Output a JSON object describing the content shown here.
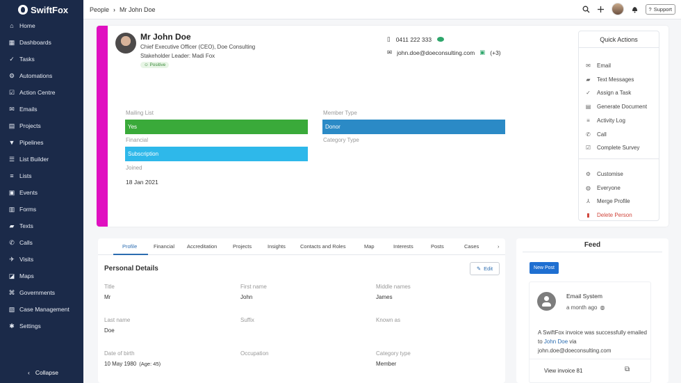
{
  "brand": {
    "name": "SwiftFox"
  },
  "sidebar": {
    "items": [
      {
        "label": "Home",
        "icon": "home-icon",
        "glyph": "⌂"
      },
      {
        "label": "Dashboards",
        "icon": "dashboard-icon",
        "glyph": "▦"
      },
      {
        "label": "Tasks",
        "icon": "tasks-icon",
        "glyph": "✓"
      },
      {
        "label": "Automations",
        "icon": "automations-icon",
        "glyph": "⚙"
      },
      {
        "label": "Action Centre",
        "icon": "action-centre-icon",
        "glyph": "☑"
      },
      {
        "label": "Emails",
        "icon": "email-icon",
        "glyph": "✉"
      },
      {
        "label": "Projects",
        "icon": "projects-icon",
        "glyph": "▤"
      },
      {
        "label": "Pipelines",
        "icon": "pipelines-icon",
        "glyph": "▼"
      },
      {
        "label": "List Builder",
        "icon": "list-builder-icon",
        "glyph": "☰"
      },
      {
        "label": "Lists",
        "icon": "lists-icon",
        "glyph": "≡"
      },
      {
        "label": "Events",
        "icon": "events-icon",
        "glyph": "▣"
      },
      {
        "label": "Forms",
        "icon": "forms-icon",
        "glyph": "▥"
      },
      {
        "label": "Texts",
        "icon": "texts-icon",
        "glyph": "▰"
      },
      {
        "label": "Calls",
        "icon": "calls-icon",
        "glyph": "✆"
      },
      {
        "label": "Visits",
        "icon": "visits-icon",
        "glyph": "✈"
      },
      {
        "label": "Maps",
        "icon": "maps-icon",
        "glyph": "◪"
      },
      {
        "label": "Governments",
        "icon": "governments-icon",
        "glyph": "⌘"
      },
      {
        "label": "Case Management",
        "icon": "case-management-icon",
        "glyph": "▧"
      },
      {
        "label": "Settings",
        "icon": "settings-icon",
        "glyph": "✱"
      }
    ],
    "collapse_label": "Collapse"
  },
  "header": {
    "breadcrumb": [
      "People",
      "Mr John Doe"
    ],
    "support_label": "Support"
  },
  "profile": {
    "name": "Mr John Doe",
    "role": "Chief Executive Officer (CEO),  Doe Consulting",
    "leader": "Stakeholder Leader:  Madi Fox",
    "sentiment": "Positive",
    "phone": "0411 222 333",
    "email": "john.doe@doeconsulting.com",
    "email_extra": "(+3)",
    "fields": {
      "mailing_list_label": "Mailing List",
      "mailing_list_value": "Yes",
      "financial_label": "Financial",
      "financial_value": "Subscription",
      "joined_label": "Joined",
      "joined_value": "18 Jan 2021",
      "member_type_label": "Member Type",
      "member_type_value": "Donor",
      "category_type_label": "Category Type"
    },
    "colors": {
      "accent": "#e010c0",
      "yes": "#3aaa3a",
      "subscription": "#2eb8ea",
      "donor": "#2b8ac6"
    }
  },
  "quick_actions": {
    "title": "Quick Actions",
    "items": [
      {
        "label": "Email",
        "icon": "email-icon",
        "glyph": "✉"
      },
      {
        "label": "Text Messages",
        "icon": "message-icon",
        "glyph": "▰"
      },
      {
        "label": "Assign a Task",
        "icon": "task-check-icon",
        "glyph": "✓"
      },
      {
        "label": "Generate Document",
        "icon": "document-icon",
        "glyph": "▤"
      },
      {
        "label": "Activity Log",
        "icon": "activity-log-icon",
        "glyph": "≡"
      },
      {
        "label": "Call",
        "icon": "phone-icon",
        "glyph": "✆"
      },
      {
        "label": "Complete Survey",
        "icon": "survey-icon",
        "glyph": "☑"
      }
    ],
    "secondary": [
      {
        "label": "Customise",
        "icon": "gear-icon",
        "glyph": "⚙"
      },
      {
        "label": "Everyone",
        "icon": "globe-icon",
        "glyph": "◍"
      },
      {
        "label": "Merge Profile",
        "icon": "merge-icon",
        "glyph": "⅄"
      },
      {
        "label": "Delete Person",
        "icon": "trash-icon",
        "glyph": "▮",
        "danger": true
      }
    ]
  },
  "tabs": [
    "Profile",
    "Financial",
    "Accreditation",
    "Projects",
    "Insights",
    "Contacts and Roles",
    "Map",
    "Interests",
    "Posts",
    "Cases"
  ],
  "personal_details": {
    "title": "Personal Details",
    "edit_label": "Edit",
    "fields": [
      {
        "label": "Title",
        "value": "Mr"
      },
      {
        "label": "First name",
        "value": "John"
      },
      {
        "label": "Middle names",
        "value": "James"
      },
      {
        "label": "Last name",
        "value": "Doe"
      },
      {
        "label": "Suffix",
        "value": ""
      },
      {
        "label": "Known as",
        "value": ""
      },
      {
        "label": "Date of birth",
        "value": "10 May 1980",
        "extra": "(Age: 45)"
      },
      {
        "label": "Occupation",
        "value": ""
      },
      {
        "label": "Category type",
        "value": "Member"
      }
    ]
  },
  "feed": {
    "title": "Feed",
    "new_post_label": "New Post",
    "post": {
      "sender": "Email System",
      "time": "a month ago",
      "message_before": "A SwiftFox invoice was successfully emailed to ",
      "message_link": "John Doe",
      "message_after": " via john.doe@doeconsulting.com",
      "invoice_label": "View invoice 81"
    }
  }
}
